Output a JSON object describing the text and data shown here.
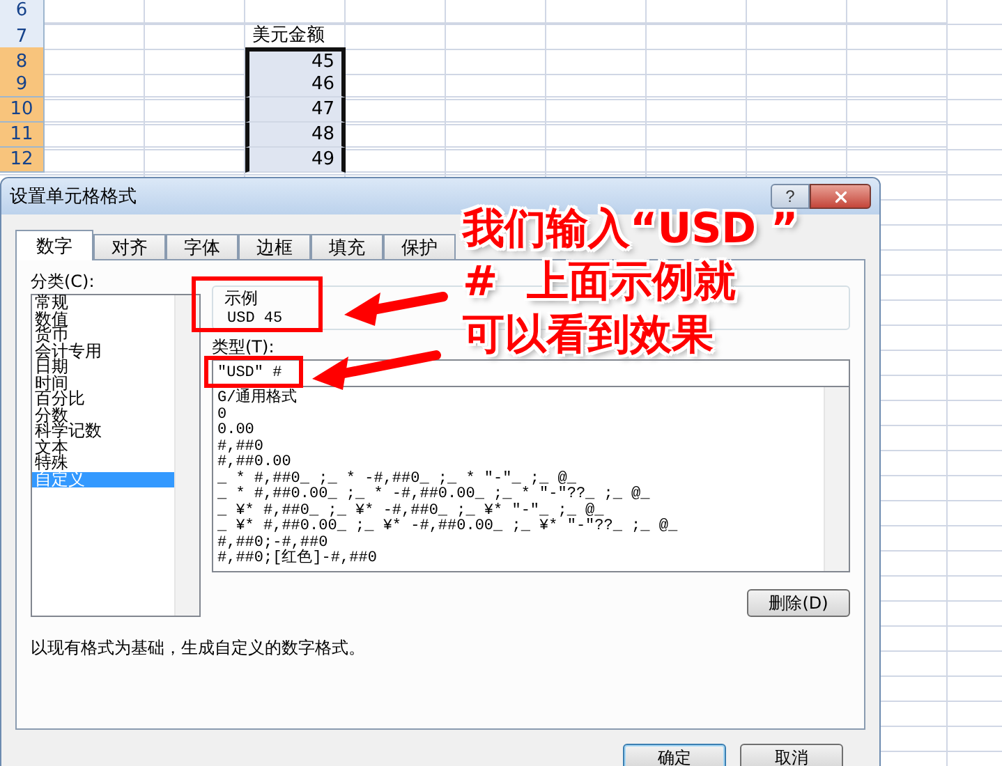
{
  "sheet": {
    "rows": [
      {
        "number": "6",
        "selected": false
      },
      {
        "number": "7",
        "selected": false,
        "value": "美元金额",
        "kind": "text"
      },
      {
        "number": "8",
        "selected": true,
        "value": "45",
        "kind": "number"
      },
      {
        "number": "9",
        "selected": true,
        "value": "46",
        "kind": "number"
      },
      {
        "number": "10",
        "selected": true,
        "value": "47",
        "kind": "number"
      },
      {
        "number": "11",
        "selected": true,
        "value": "48",
        "kind": "number"
      },
      {
        "number": "12",
        "selected": true,
        "value": "49",
        "kind": "number"
      }
    ]
  },
  "dialog": {
    "title": "设置单元格格式",
    "help": "?",
    "tabs": [
      {
        "label": "数字",
        "selected": true
      },
      {
        "label": "对齐",
        "selected": false
      },
      {
        "label": "字体",
        "selected": false
      },
      {
        "label": "边框",
        "selected": false
      },
      {
        "label": "填充",
        "selected": false
      },
      {
        "label": "保护",
        "selected": false
      }
    ],
    "category_label": "分类(C):",
    "categories": [
      {
        "label": "常规",
        "selected": false
      },
      {
        "label": "数值",
        "selected": false
      },
      {
        "label": "货币",
        "selected": false
      },
      {
        "label": "会计专用",
        "selected": false
      },
      {
        "label": "日期",
        "selected": false
      },
      {
        "label": "时间",
        "selected": false
      },
      {
        "label": "百分比",
        "selected": false
      },
      {
        "label": "分数",
        "selected": false
      },
      {
        "label": "科学记数",
        "selected": false
      },
      {
        "label": "文本",
        "selected": false
      },
      {
        "label": "特殊",
        "selected": false
      },
      {
        "label": "自定义",
        "selected": true
      }
    ],
    "sample": {
      "label": "示例",
      "value": "USD 45"
    },
    "type_label": "类型(T):",
    "type_value": "\"USD\" #",
    "formats": [
      "G/通用格式",
      "0",
      "0.00",
      "#,##0",
      "#,##0.00",
      "_ * #,##0_ ;_ * -#,##0_ ;_ * \"-\"_ ;_ @_",
      "_ * #,##0.00_ ;_ * -#,##0.00_ ;_ * \"-\"??_ ;_ @_",
      "_ ¥* #,##0_ ;_ ¥* -#,##0_ ;_ ¥* \"-\"_ ;_ @_",
      "_ ¥* #,##0.00_ ;_ ¥* -#,##0.00_ ;_ ¥* \"-\"??_ ;_ @_",
      "#,##0;-#,##0",
      "#,##0;[红色]-#,##0"
    ],
    "delete_button": "删除(D)",
    "description": "以现有格式为基础，生成自定义的数字格式。",
    "buttons": [
      {
        "label": "确定",
        "default": true
      },
      {
        "label": "取消",
        "default": false
      }
    ]
  },
  "annotation": {
    "lines": [
      "我们输入“USD ”",
      "#  上面示例就",
      "可以看到效果"
    ]
  }
}
